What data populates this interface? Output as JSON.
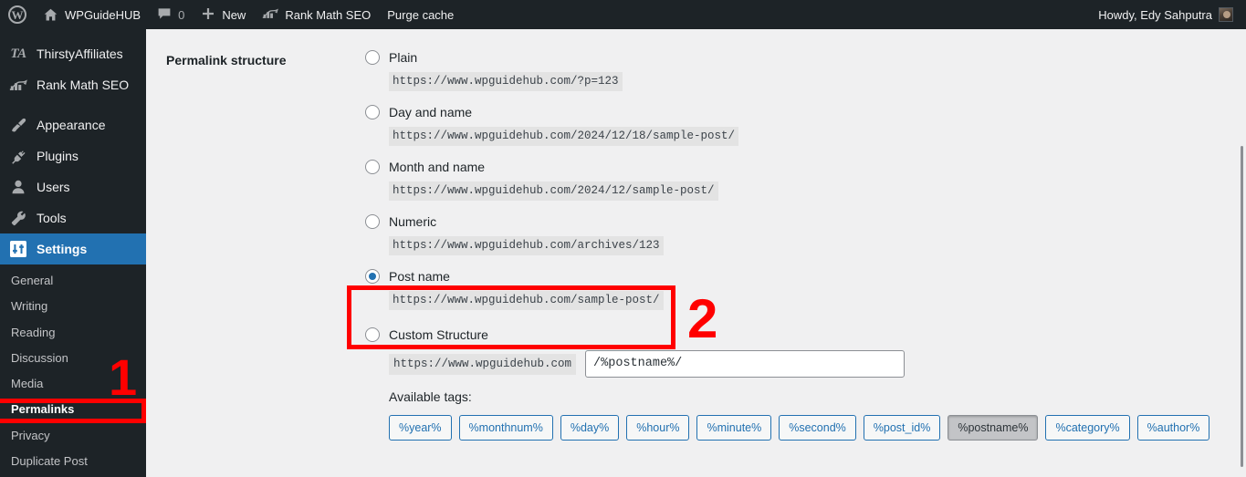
{
  "adminbar": {
    "wp_logo": "wordpress-logo",
    "site_name": "WPGuideHUB",
    "comment_count": "0",
    "new_label": "New",
    "rank_math_label": "Rank Math SEO",
    "purge_cache_label": "Purge cache",
    "howdy": "Howdy, Edy Sahputra"
  },
  "sidebar": {
    "top_items": [
      {
        "label": "ThirstyAffiliates",
        "icon": "thirsty-affiliates-icon"
      },
      {
        "label": "Rank Math SEO",
        "icon": "rank-math-icon"
      },
      {
        "label": "Appearance",
        "icon": "paintbrush-icon"
      },
      {
        "label": "Plugins",
        "icon": "plug-icon"
      },
      {
        "label": "Users",
        "icon": "user-icon"
      },
      {
        "label": "Tools",
        "icon": "wrench-icon"
      },
      {
        "label": "Settings",
        "icon": "settings-sliders-icon"
      }
    ],
    "submenu": [
      {
        "label": "General"
      },
      {
        "label": "Writing"
      },
      {
        "label": "Reading"
      },
      {
        "label": "Discussion"
      },
      {
        "label": "Media"
      },
      {
        "label": "Permalinks"
      },
      {
        "label": "Privacy"
      },
      {
        "label": "Duplicate Post"
      }
    ],
    "current_top": "Settings",
    "current_sub": "Permalinks"
  },
  "main": {
    "row_label": "Permalink structure",
    "options": [
      {
        "label": "Plain",
        "url": "https://www.wpguidehub.com/?p=123",
        "selected": false
      },
      {
        "label": "Day and name",
        "url": "https://www.wpguidehub.com/2024/12/18/sample-post/",
        "selected": false
      },
      {
        "label": "Month and name",
        "url": "https://www.wpguidehub.com/2024/12/sample-post/",
        "selected": false
      },
      {
        "label": "Numeric",
        "url": "https://www.wpguidehub.com/archives/123",
        "selected": false
      },
      {
        "label": "Post name",
        "url": "https://www.wpguidehub.com/sample-post/",
        "selected": true
      }
    ],
    "custom_structure": {
      "label": "Custom Structure",
      "selected": false,
      "prefix": "https://www.wpguidehub.com",
      "value": "/%postname%/"
    },
    "available_tags_label": "Available tags:",
    "tags": [
      {
        "label": "%year%",
        "active": false
      },
      {
        "label": "%monthnum%",
        "active": false
      },
      {
        "label": "%day%",
        "active": false
      },
      {
        "label": "%hour%",
        "active": false
      },
      {
        "label": "%minute%",
        "active": false
      },
      {
        "label": "%second%",
        "active": false
      },
      {
        "label": "%post_id%",
        "active": false
      },
      {
        "label": "%postname%",
        "active": true
      },
      {
        "label": "%category%",
        "active": false
      },
      {
        "label": "%author%",
        "active": false
      }
    ]
  },
  "annotations": [
    {
      "number": "1",
      "target": "Permalinks sidebar item"
    },
    {
      "number": "2",
      "target": "Post name option"
    }
  ],
  "colors": {
    "admin_dark": "#1d2327",
    "accent_blue": "#2271b1",
    "annotation_red": "#ff0000",
    "content_bg": "#f0f0f1"
  }
}
